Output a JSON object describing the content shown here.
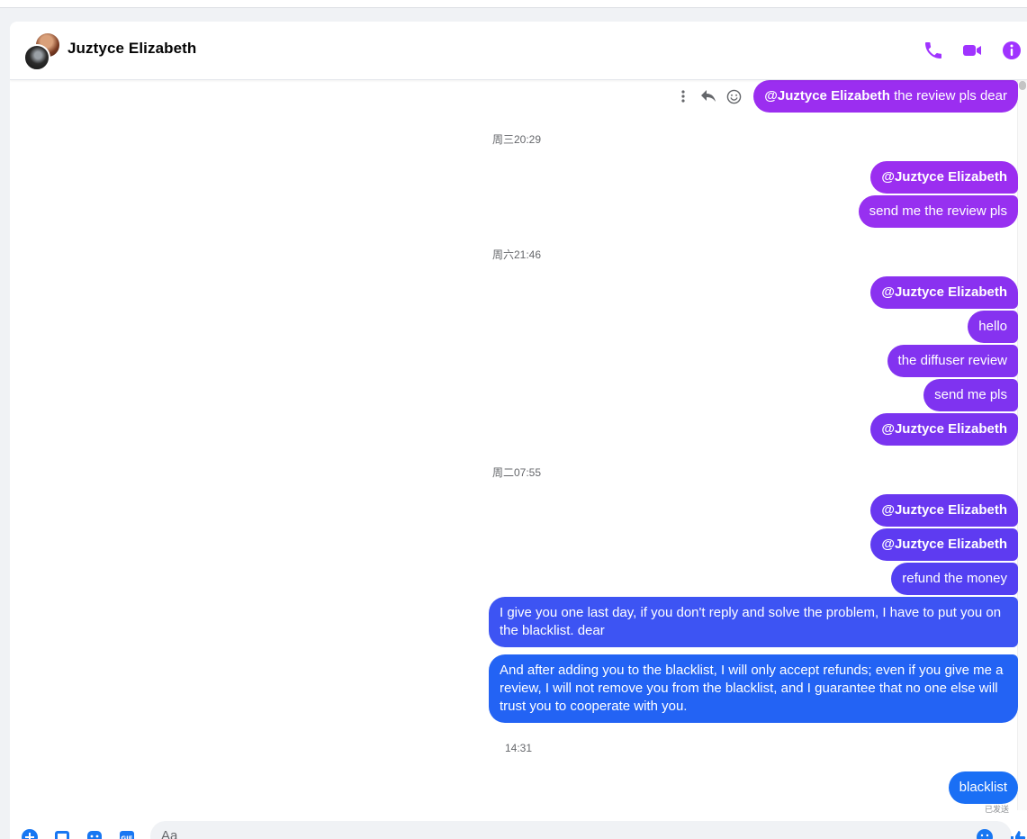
{
  "conversation": {
    "name": "Juztyce Elizabeth"
  },
  "hover_message": {
    "mention": "@Juztyce Elizabeth",
    "text": " the review pls dear"
  },
  "groups": [
    {
      "timestamp": "周三20:29",
      "messages": [
        {
          "mention": "@Juztyce Elizabeth",
          "text": ""
        },
        {
          "mention": "",
          "text": "send me the review pls"
        }
      ]
    },
    {
      "timestamp": "周六21:46",
      "messages": [
        {
          "mention": "@Juztyce Elizabeth",
          "text": ""
        },
        {
          "mention": "",
          "text": "hello"
        },
        {
          "mention": "",
          "text": "the diffuser review"
        },
        {
          "mention": "",
          "text": "send me pls"
        },
        {
          "mention": "@Juztyce Elizabeth",
          "text": ""
        }
      ]
    },
    {
      "timestamp": "周二07:55",
      "messages": [
        {
          "mention": "@Juztyce Elizabeth",
          "text": ""
        },
        {
          "mention": "@Juztyce Elizabeth",
          "text": ""
        },
        {
          "mention": "",
          "text": "refund the money"
        },
        {
          "mention": "",
          "text": "I give you one last day, if you don't reply and solve the problem, I have to put you on the blacklist. dear"
        },
        {
          "mention": "",
          "text": "And after adding you to the blacklist, I will only accept refunds; even if you give me a review, I will not remove you from the blacklist, and I guarantee that no one else will trust you to cooperate with you."
        }
      ]
    },
    {
      "timestamp": "14:31",
      "messages": [
        {
          "mention": "",
          "text": "blacklist"
        }
      ]
    }
  ],
  "seen_label": "已发送",
  "composer": {
    "placeholder": "Aa"
  },
  "icons": {
    "header": [
      "phone-icon",
      "video-icon",
      "info-icon"
    ],
    "hover": [
      "more-icon",
      "reply-icon",
      "react-icon"
    ],
    "composer": [
      "plus-icon",
      "gallery-icon",
      "sticker-icon",
      "gif-icon",
      "emoji-icon",
      "thumbs-up-icon"
    ]
  },
  "colors": {
    "accent": "#a033ff",
    "bubble_top": "#9b2ef0",
    "bubble_mid": "#6a36f0",
    "bubble_bottom": "#1d74f5",
    "timestamp": "#65676b"
  }
}
